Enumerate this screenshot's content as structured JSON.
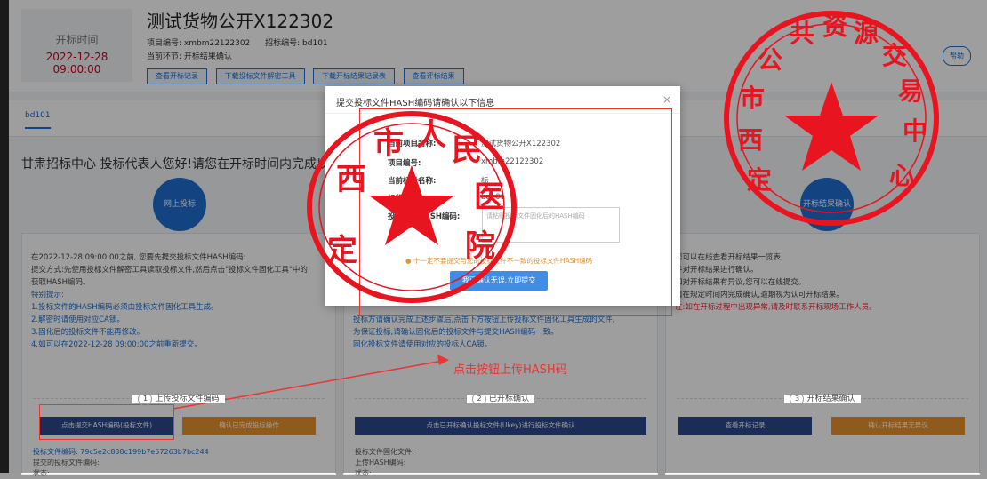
{
  "header": {
    "time_label": "开标时间",
    "time_value": "2022-12-28 09:00:00",
    "project_title": "测试货物公开X122302",
    "meta": [
      "项目编号: xmbm22122302",
      "招标编号: bd101",
      "当前环节: 开标结果确认"
    ],
    "buttons": [
      "查看开标记录",
      "下载投标文件解密工具",
      "下载开标结果记录表",
      "查看评标结果"
    ],
    "help_label": "帮助"
  },
  "tabs": [
    "bd101"
  ],
  "greeting": "甘肃招标中心 投标代表人您好!请您在开标时间内完成以下操作",
  "cards": {
    "left": {
      "circle": "网上投标",
      "lines": [
        "在2022-12-28 09:00:00之前, 您要先提交投标文件HASH编码:",
        "提交方式:先使用投标文件解密工具读取投标文件,然后点击\"投标文件固化工具\"中的",
        "获取HASH编码。",
        "特别提示:",
        "1.投标文件的HASH编码必须由投标文件固化工具生成。",
        "2.解密时请使用对应CA锁。",
        "3.固化后的投标文件不能再修改。",
        "4.如可以在2022-12-28 09:00:00之前重新提交。"
      ],
      "step_num": "1",
      "step_label": "上传投标文件编码",
      "button_primary": "点击提交HASH编码(投标文件)",
      "button_secondary": "确认已完成投标操作",
      "bottom_labels": [
        "投标文件编码: 79c5e2c838c199b7e57263b7bc244",
        "提交的投标文件编码:",
        "状态:"
      ]
    },
    "middle": {
      "lines": [
        "投标方请确认完成上述步骤后,点击下方按钮上传投标文件固化工具生成的文件,",
        "为保证投标,请确认固化后的投标文件与提交HASH编码一致。",
        "固化投标文件请使用对应的投标人CA锁。"
      ],
      "step_num": "2",
      "step_label": "已开标确认",
      "button_primary": "点击已开标确认投标文件(Ukey)进行投标文件确认",
      "bottom_labels": [
        "投标文件固化文件:",
        "上传HASH编码:",
        "状态:"
      ]
    },
    "right": {
      "circle": "开标结果确认",
      "lines": [
        "您可以在线查看开标结果一览表,",
        "并对开标结果进行确认。",
        "如对开标结果有异议,您可以在线提交。",
        "请在规定时间内完成确认,逾期视为认可开标结果。",
        "注:如在开标过程中出现异常,请及时联系开标现场工作人员。"
      ],
      "step_num": "3",
      "step_label": "开标结果确认",
      "button_primary": "查看开标记录",
      "button_secondary": "确认开标结果无异议"
    }
  },
  "modal": {
    "title": "提交投标文件HASH编码请确认以下信息",
    "close": "×",
    "rows": [
      {
        "label": "当前项目名称:",
        "value": "测试货物公开X122302"
      },
      {
        "label": "项目编号:",
        "value": "xmbm22122302"
      },
      {
        "label": "当前标段名称:",
        "value": "标一"
      },
      {
        "label": "标段编号:",
        "value": "bd101"
      },
      {
        "label": "投标文件HASH编码:",
        "value": ""
      }
    ],
    "input_placeholder": "请粘贴投标文件固化后的HASH编码",
    "warning": "● 十一定不要提交与您的投标文件不一致的投标文件HASH编码",
    "submit": "我已确认无误,立即提交"
  },
  "annotation": {
    "text": "点击按钮上传HASH码",
    "color": "#ee3333"
  },
  "stamps": {
    "color": "#e8141f",
    "left_text": "定西市人民医院",
    "right_text": "定西市公共资源交易中心"
  }
}
